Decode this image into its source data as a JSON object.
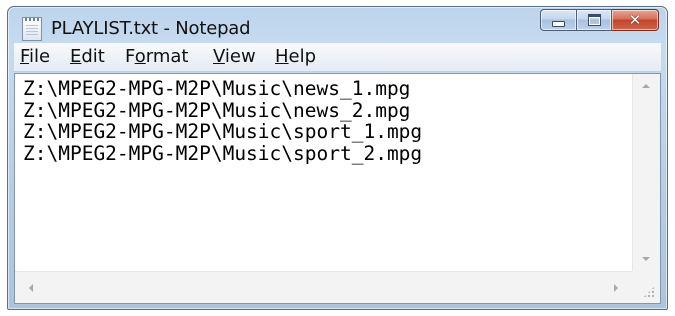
{
  "window": {
    "title": "PLAYLIST.txt - Notepad",
    "close_glyph": "✕"
  },
  "menu": {
    "items": [
      {
        "label": "File",
        "accel": "F",
        "rest": "ile"
      },
      {
        "label": "Edit",
        "accel": "E",
        "rest": "dit"
      },
      {
        "label": "Format",
        "pre": "F",
        "accel": "o",
        "rest": "rmat"
      },
      {
        "label": "View",
        "accel": "V",
        "rest": "iew"
      },
      {
        "label": "Help",
        "accel": "H",
        "rest": "elp"
      }
    ]
  },
  "editor": {
    "lines": [
      "Z:\\MPEG2-MPG-M2P\\Music\\news_1.mpg",
      "Z:\\MPEG2-MPG-M2P\\Music\\news_2.mpg",
      "Z:\\MPEG2-MPG-M2P\\Music\\sport_1.mpg",
      "Z:\\MPEG2-MPG-M2P\\Music\\sport_2.mpg"
    ]
  },
  "icons": {
    "app": "notepad-icon",
    "minimize": "minimize-icon",
    "maximize": "maximize-icon",
    "close": "close-icon"
  },
  "colors": {
    "close_button": "#c2452a",
    "frame": "#bcd4ec"
  }
}
